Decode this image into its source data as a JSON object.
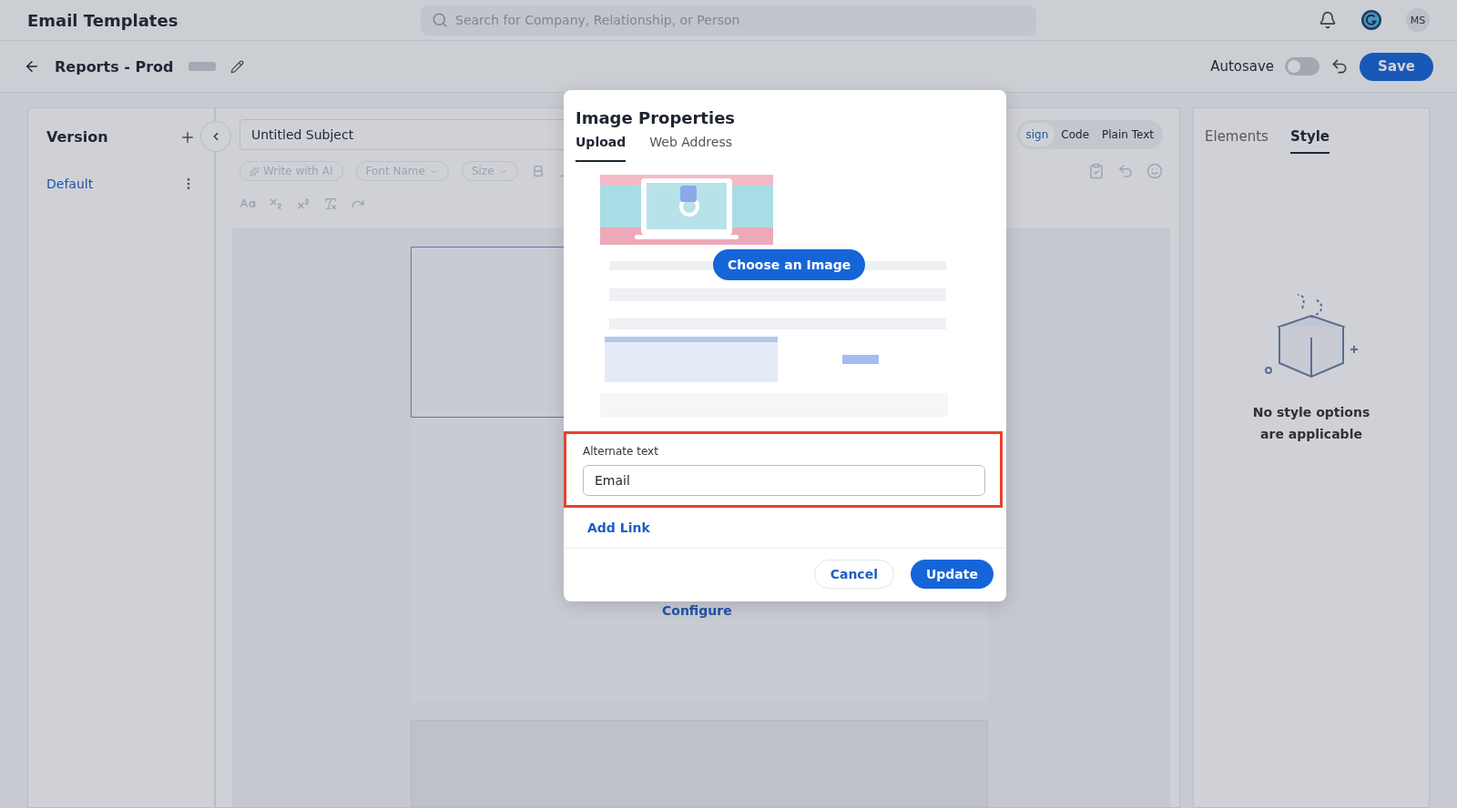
{
  "app": {
    "title": "Email Templates",
    "search": {
      "placeholder": "Search for Company, Relationship, or Person"
    },
    "avatar": "MS"
  },
  "header": {
    "title": "Reports - Prod",
    "autosave": {
      "label": "Autosave",
      "on": false
    },
    "save": "Save"
  },
  "versions": {
    "title": "Version",
    "items": [
      {
        "label": "Default",
        "selected": true
      }
    ]
  },
  "editor": {
    "subject": "Untitled Subject",
    "modes": [
      {
        "label": "sign",
        "selected": true
      },
      {
        "label": "Code",
        "selected": false
      },
      {
        "label": "Plain Text",
        "selected": false
      }
    ],
    "toolbar": [
      "Write with AI",
      "Font Name",
      "Size"
    ],
    "configure": "Configure"
  },
  "side_panel": {
    "tabs": [
      {
        "label": "Elements",
        "selected": false
      },
      {
        "label": "Style",
        "selected": true
      }
    ],
    "empty_message": "No style options are applicable"
  },
  "dialog": {
    "title": "Image Properties",
    "tabs": [
      {
        "label": "Upload",
        "selected": true
      },
      {
        "label": "Web Address",
        "selected": false
      }
    ],
    "choose_button": "Choose an Image",
    "alt_text": {
      "label": "Alternate text",
      "value": "Email",
      "highlighted": true
    },
    "add_link": "Add Link",
    "cancel": "Cancel",
    "update": "Update"
  }
}
